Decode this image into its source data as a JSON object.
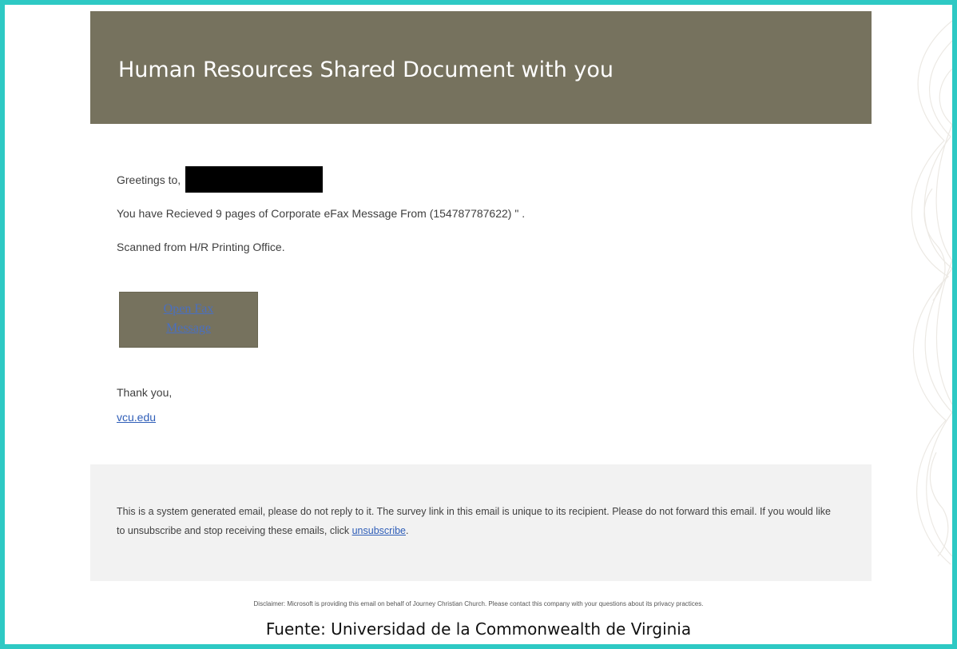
{
  "email": {
    "title": "Human Resources Shared Document with you",
    "greeting": "Greetings to,",
    "received_line": "You have Recieved 9 pages of  Corporate eFax Message From (154787787622) \" .",
    "scanned_line": "Scanned from H/R Printing Office.",
    "button": {
      "line1": "Open Fax",
      "line2": "Message"
    },
    "signoff": "Thank you,",
    "signoff_link": "vcu.edu",
    "footer_text": "This is a system generated email, please do not reply to it. The survey link in this email is unique to its recipient. Please do not forward this email. If you would like to unsubscribe and stop receiving these emails, click ",
    "footer_link": "unsubscribe",
    "footer_end": ".",
    "disclaimer": "Disclaimer: Microsoft is providing this email on behalf of Journey Christian Church. Please contact this company with your questions about its privacy practices."
  },
  "caption": "Fuente: Universidad de la Commonwealth de Virginia",
  "colors": {
    "frame_border": "#2ec9c4",
    "banner_bg": "#76725e",
    "footer_bg": "#f2f2f2",
    "link": "#2f5eb8"
  }
}
